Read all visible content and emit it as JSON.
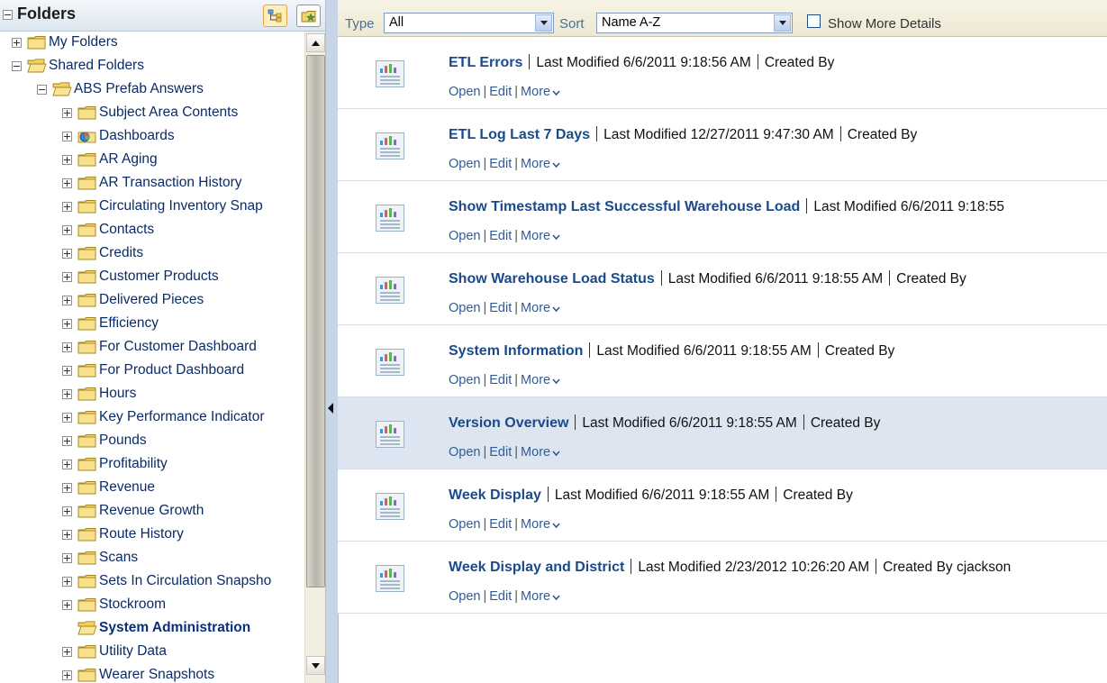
{
  "left_pane": {
    "title": "Folders",
    "tree": [
      {
        "label": "My Folders",
        "level": 0,
        "expander": "plus",
        "icon": "folder-closed-icon"
      },
      {
        "label": "Shared Folders",
        "level": 0,
        "expander": "minus",
        "icon": "folder-open-icon"
      },
      {
        "label": "ABS Prefab Answers",
        "level": 1,
        "expander": "minus",
        "icon": "folder-open-icon"
      },
      {
        "label": "Subject Area Contents",
        "level": 2,
        "expander": "plus",
        "icon": "folder-closed-icon"
      },
      {
        "label": "Dashboards",
        "level": 2,
        "expander": "plus",
        "icon": "dashboard-folder-icon"
      },
      {
        "label": "AR Aging",
        "level": 2,
        "expander": "plus",
        "icon": "folder-closed-icon"
      },
      {
        "label": "AR Transaction History",
        "level": 2,
        "expander": "plus",
        "icon": "folder-closed-icon"
      },
      {
        "label": "Circulating Inventory Snap",
        "level": 2,
        "expander": "plus",
        "icon": "folder-closed-icon"
      },
      {
        "label": "Contacts",
        "level": 2,
        "expander": "plus",
        "icon": "folder-closed-icon"
      },
      {
        "label": "Credits",
        "level": 2,
        "expander": "plus",
        "icon": "folder-closed-icon"
      },
      {
        "label": "Customer Products",
        "level": 2,
        "expander": "plus",
        "icon": "folder-closed-icon"
      },
      {
        "label": "Delivered Pieces",
        "level": 2,
        "expander": "plus",
        "icon": "folder-closed-icon"
      },
      {
        "label": "Efficiency",
        "level": 2,
        "expander": "plus",
        "icon": "folder-closed-icon"
      },
      {
        "label": "For Customer Dashboard",
        "level": 2,
        "expander": "plus",
        "icon": "folder-closed-icon"
      },
      {
        "label": "For Product Dashboard",
        "level": 2,
        "expander": "plus",
        "icon": "folder-closed-icon"
      },
      {
        "label": "Hours",
        "level": 2,
        "expander": "plus",
        "icon": "folder-closed-icon"
      },
      {
        "label": "Key Performance Indicator",
        "level": 2,
        "expander": "plus",
        "icon": "folder-closed-icon"
      },
      {
        "label": "Pounds",
        "level": 2,
        "expander": "plus",
        "icon": "folder-closed-icon"
      },
      {
        "label": "Profitability",
        "level": 2,
        "expander": "plus",
        "icon": "folder-closed-icon"
      },
      {
        "label": "Revenue",
        "level": 2,
        "expander": "plus",
        "icon": "folder-closed-icon"
      },
      {
        "label": "Revenue Growth",
        "level": 2,
        "expander": "plus",
        "icon": "folder-closed-icon"
      },
      {
        "label": "Route History",
        "level": 2,
        "expander": "plus",
        "icon": "folder-closed-icon"
      },
      {
        "label": "Scans",
        "level": 2,
        "expander": "plus",
        "icon": "folder-closed-icon"
      },
      {
        "label": "Sets In Circulation Snapsho",
        "level": 2,
        "expander": "plus",
        "icon": "folder-closed-icon"
      },
      {
        "label": "Stockroom",
        "level": 2,
        "expander": "plus",
        "icon": "folder-closed-icon"
      },
      {
        "label": "System Administration",
        "level": 2,
        "expander": "none",
        "icon": "folder-open-icon",
        "selected": true
      },
      {
        "label": "Utility Data",
        "level": 2,
        "expander": "plus",
        "icon": "folder-closed-icon"
      },
      {
        "label": "Wearer Snapshots",
        "level": 2,
        "expander": "plus",
        "icon": "folder-closed-icon"
      }
    ]
  },
  "toolbar": {
    "type_label": "Type",
    "type_value": "All",
    "sort_label": "Sort",
    "sort_value": "Name A-Z",
    "show_more_label": "Show More Details"
  },
  "items": [
    {
      "title": "ETL Errors",
      "last_modified": "Last Modified 6/6/2011 9:18:56 AM",
      "created_by": "Created By"
    },
    {
      "title": "ETL Log Last 7 Days",
      "last_modified": "Last Modified 12/27/2011 9:47:30 AM",
      "created_by": "Created By"
    },
    {
      "title": "Show Timestamp Last Successful Warehouse Load",
      "last_modified": "Last Modified 6/6/2011 9:18:55",
      "created_by": ""
    },
    {
      "title": "Show Warehouse Load Status",
      "last_modified": "Last Modified 6/6/2011 9:18:55 AM",
      "created_by": "Created By"
    },
    {
      "title": "System Information",
      "last_modified": "Last Modified 6/6/2011 9:18:55 AM",
      "created_by": "Created By"
    },
    {
      "title": "Version Overview",
      "last_modified": "Last Modified 6/6/2011 9:18:55 AM",
      "created_by": "Created By",
      "highlighted": true
    },
    {
      "title": "Week Display",
      "last_modified": "Last Modified 6/6/2011 9:18:55 AM",
      "created_by": "Created By"
    },
    {
      "title": "Week Display and District",
      "last_modified": "Last Modified 2/23/2012 10:26:20 AM",
      "created_by": "Created By cjackson"
    }
  ],
  "item_actions": {
    "open": "Open",
    "edit": "Edit",
    "more": "More"
  },
  "colors": {
    "link": "#1a4a8c",
    "highlight_row": "#dde6f0",
    "folder": "#f4d35e",
    "toolbar": "#f1ecd8"
  }
}
